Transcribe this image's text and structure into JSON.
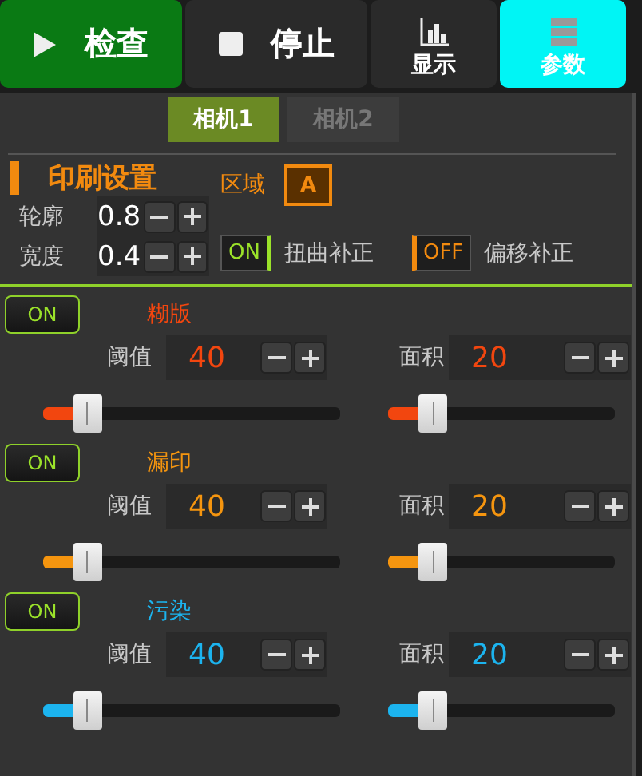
{
  "toolbar": [
    {
      "kind": "run",
      "label": "检查",
      "selected": false
    },
    {
      "kind": "stop",
      "label": "停止",
      "selected": false
    },
    {
      "kind": "chart",
      "label": "显示",
      "selected": false
    },
    {
      "kind": "params",
      "label": "参数",
      "selected": true
    }
  ],
  "camera_tabs": [
    {
      "label": "相机1",
      "selected": true
    },
    {
      "label": "相机2",
      "selected": false
    }
  ],
  "print_settings": {
    "title": "印刷设置",
    "region_label": "区域",
    "region_value": "A",
    "params": [
      {
        "label": "轮廓",
        "value": "0.8"
      },
      {
        "label": "宽度",
        "value": "0.4"
      }
    ],
    "toggles": [
      {
        "state": "ON",
        "on": true,
        "label": "扭曲补正"
      },
      {
        "state": "OFF",
        "on": false,
        "label": "偏移补正"
      }
    ]
  },
  "defects": [
    {
      "toggle": "ON",
      "on": true,
      "name": "糊版",
      "color": "#f2460f",
      "threshold": {
        "label": "阈值",
        "value": "40",
        "level": 0.15
      },
      "area": {
        "label": "面积",
        "value": "20",
        "level": 0.2
      }
    },
    {
      "toggle": "ON",
      "on": true,
      "name": "漏印",
      "color": "#f5950f",
      "threshold": {
        "label": "阈值",
        "value": "40",
        "level": 0.15
      },
      "area": {
        "label": "面积",
        "value": "20",
        "level": 0.2
      }
    },
    {
      "toggle": "ON",
      "on": true,
      "name": "污染",
      "color": "#1cb4ef",
      "threshold": {
        "label": "阈值",
        "value": "40",
        "level": 0.15
      },
      "area": {
        "label": "面积",
        "value": "20",
        "level": 0.2
      }
    }
  ]
}
